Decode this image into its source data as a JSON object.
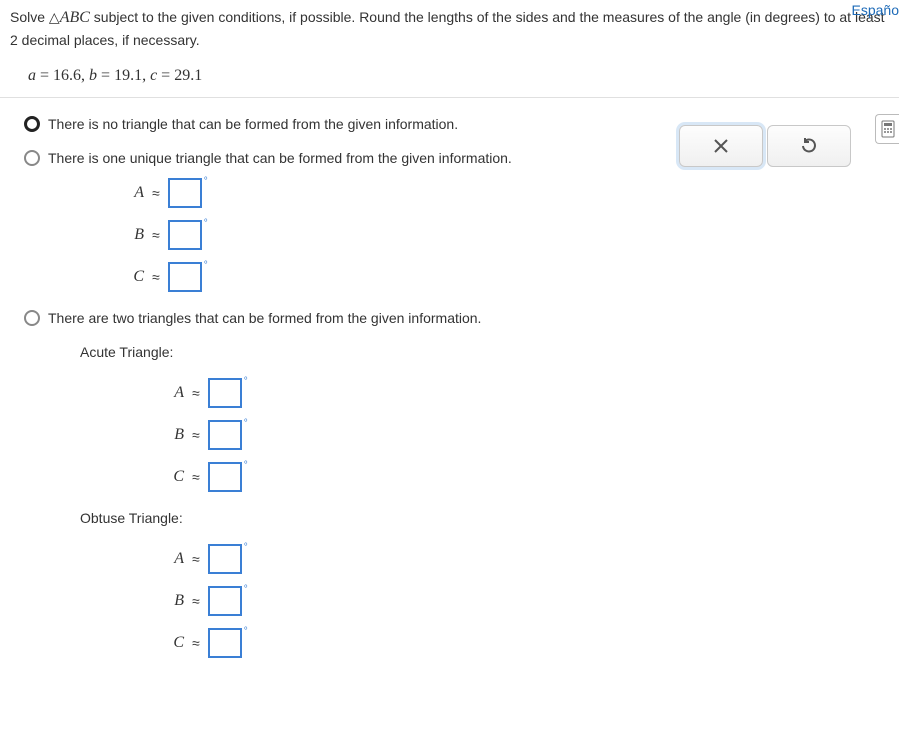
{
  "lang_link": "Españo",
  "prompt": {
    "part1": "Solve ",
    "triangle_symbol": "△",
    "abc": "ABC",
    "part2": " subject to the given conditions, if possible. Round the lengths of the sides and the measures of the angle (in degrees) to at least ",
    "two": "2",
    "part3": " decimal places, if necessary."
  },
  "equation": {
    "a_label": "a",
    "a_eq": " = ",
    "a_val": "16.6",
    "b_label": "b",
    "b_eq": " = ",
    "b_val": "19.1",
    "c_label": "c",
    "c_eq": " = ",
    "c_val": "29.1",
    "sep": ", "
  },
  "options": {
    "none": "There is no triangle that can be formed from the given information.",
    "one": "There is one unique triangle that can be formed from the given information.",
    "two": "There are two triangles that can be formed from the given information."
  },
  "labels": {
    "A": "A",
    "B": "B",
    "C": "C",
    "approx": "≈",
    "acute": "Acute Triangle:",
    "obtuse": "Obtuse Triangle:",
    "degree": "°"
  },
  "tools": {
    "clear": "×",
    "reset": "↺"
  }
}
